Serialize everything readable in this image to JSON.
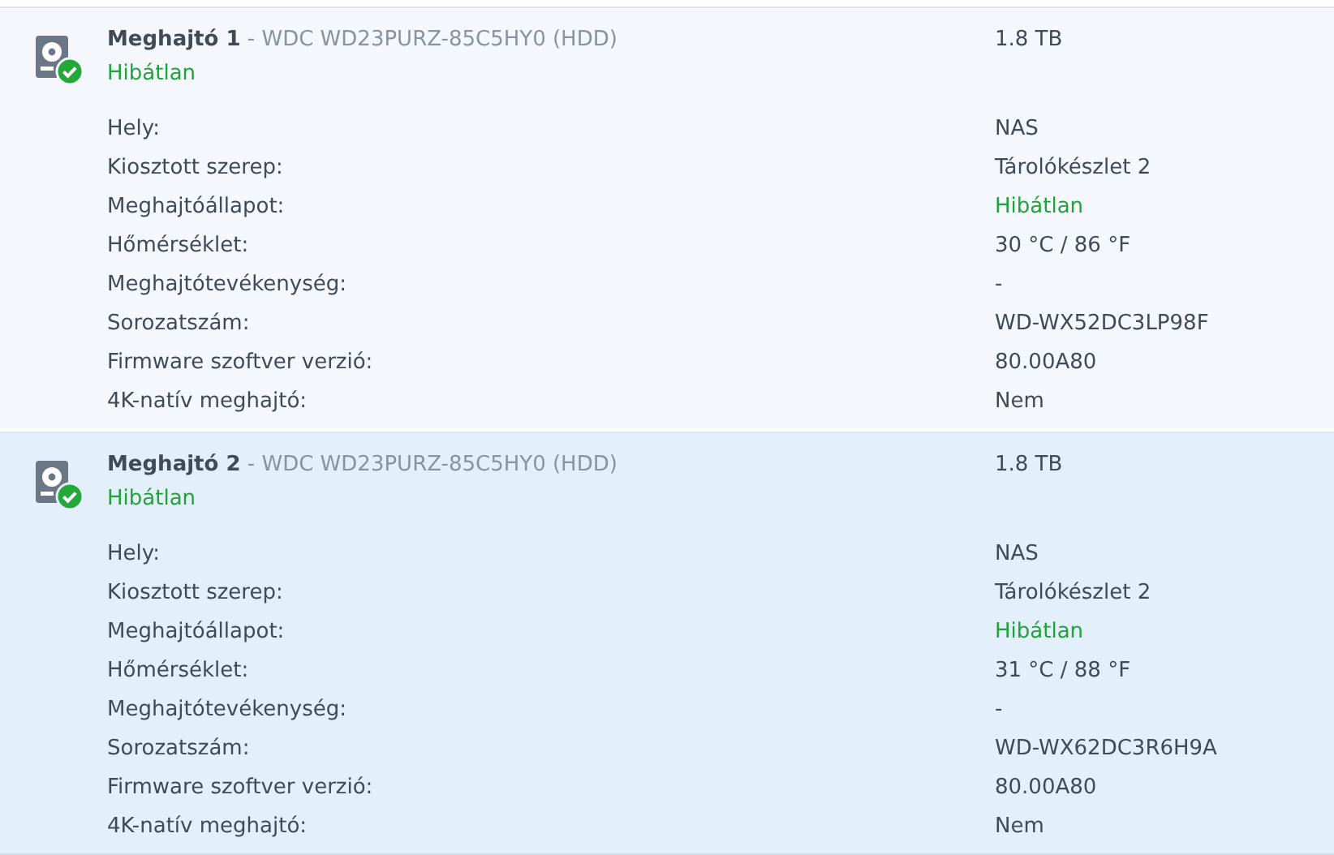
{
  "drives": [
    {
      "selected": false,
      "name": "Meghajtó 1",
      "model": "- WDC WD23PURZ-85C5HY0 (HDD)",
      "health": "Hibátlan",
      "healthy": true,
      "size": "1.8 TB",
      "details": [
        {
          "label": "Hely:",
          "value": "NAS",
          "kind": "text"
        },
        {
          "label": "Kiosztott szerep:",
          "value": "Tárolókészlet 2",
          "kind": "text"
        },
        {
          "label": "Meghajtóállapot:",
          "value": "Hibátlan",
          "kind": "status"
        },
        {
          "label": "Hőmérséklet:",
          "value": "30 °C / 86 °F",
          "kind": "text"
        },
        {
          "label": "Meghajtótevékenység:",
          "value": "-",
          "kind": "text"
        },
        {
          "label": "Sorozatszám:",
          "value": "WD-WX52DC3LP98F",
          "kind": "text"
        },
        {
          "label": "Firmware szoftver verzió:",
          "value": "80.00A80",
          "kind": "text"
        },
        {
          "label": "4K-natív meghajtó:",
          "value": "Nem",
          "kind": "text"
        }
      ]
    },
    {
      "selected": true,
      "name": "Meghajtó 2",
      "model": "- WDC WD23PURZ-85C5HY0 (HDD)",
      "health": "Hibátlan",
      "healthy": true,
      "size": "1.8 TB",
      "details": [
        {
          "label": "Hely:",
          "value": "NAS",
          "kind": "text"
        },
        {
          "label": "Kiosztott szerep:",
          "value": "Tárolókészlet 2",
          "kind": "text"
        },
        {
          "label": "Meghajtóállapot:",
          "value": "Hibátlan",
          "kind": "status"
        },
        {
          "label": "Hőmérséklet:",
          "value": "31 °C / 88 °F",
          "kind": "text"
        },
        {
          "label": "Meghajtótevékenység:",
          "value": "-",
          "kind": "text"
        },
        {
          "label": "Sorozatszám:",
          "value": "WD-WX62DC3R6H9A",
          "kind": "text"
        },
        {
          "label": "Firmware szoftver verzió:",
          "value": "80.00A80",
          "kind": "text"
        },
        {
          "label": "4K-natív meghajtó:",
          "value": "Nem",
          "kind": "text"
        }
      ]
    }
  ]
}
